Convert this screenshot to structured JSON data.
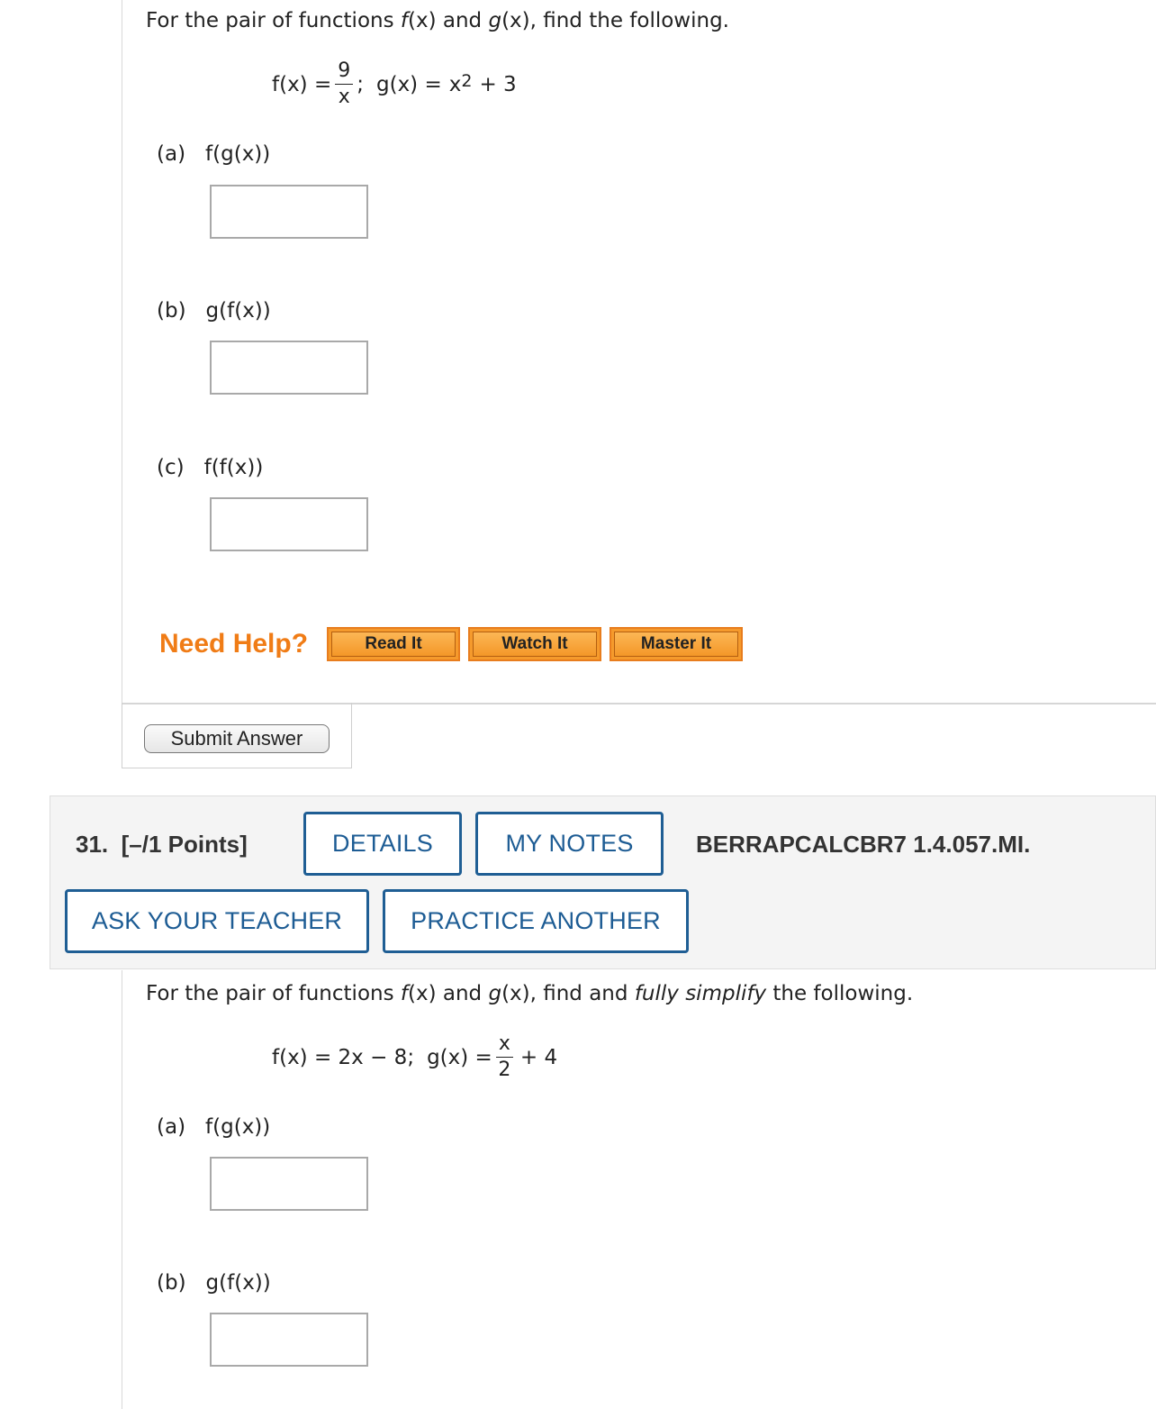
{
  "q30": {
    "intro_pre": "For the pair of functions ",
    "f_sym": "f",
    "x1": "(x) and ",
    "g_sym": "g",
    "x2": "(x), find the following.",
    "def": {
      "f_lhs": "f(x) =",
      "f_num": "9",
      "f_den": "x",
      "sep": ";",
      "g_lhs": "g(x) =",
      "g_rhs": "x",
      "g_exp": "2",
      "g_tail": "+ 3"
    },
    "parts": [
      {
        "label": "(a)",
        "expr": "f(g(x))"
      },
      {
        "label": "(b)",
        "expr": "g(f(x))"
      },
      {
        "label": "(c)",
        "expr": "f(f(x))"
      }
    ],
    "need_help": "Need Help?",
    "help_buttons": [
      "Read It",
      "Watch It",
      "Master It"
    ],
    "submit": "Submit Answer"
  },
  "q31": {
    "number": "31.",
    "points": "[–/1 Points]",
    "details": "DETAILS",
    "my_notes": "MY NOTES",
    "code": "BERRAPCALCBR7 1.4.057.MI.",
    "ask_teacher": "ASK YOUR TEACHER",
    "practice": "PRACTICE ANOTHER",
    "intro_pre": "For the pair of functions ",
    "f_sym": "f",
    "x1": "(x) and ",
    "g_sym": "g",
    "x2": "(x), find and ",
    "emph": "fully simplify",
    "x3": " the following.",
    "def": {
      "f_expr": "f(x) = 2x − 8;",
      "g_lhs": "g(x) =",
      "g_num": "x",
      "g_den": "2",
      "g_tail": "+ 4"
    },
    "parts": [
      {
        "label": "(a)",
        "expr": "f(g(x))"
      },
      {
        "label": "(b)",
        "expr": "g(f(x))"
      }
    ]
  }
}
